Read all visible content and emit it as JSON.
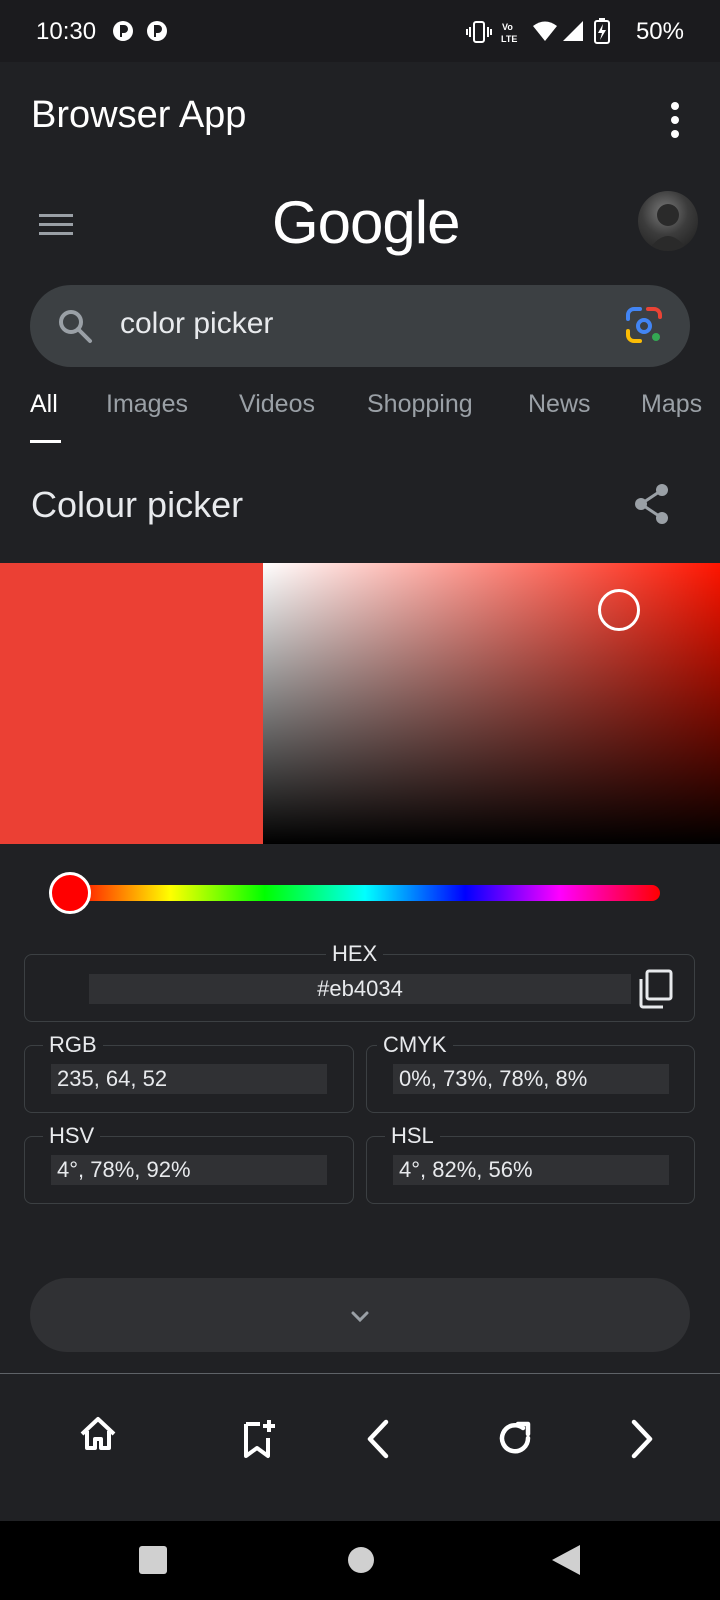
{
  "status_bar": {
    "time": "10:30",
    "battery": "50%",
    "icons": [
      "app-notification-icon",
      "app-notification-icon",
      "vibrate-icon",
      "volte-icon",
      "wifi-icon",
      "signal-icon",
      "battery-charging-icon"
    ]
  },
  "app_bar": {
    "title": "Browser App",
    "overflow_icon": "more-vert-icon"
  },
  "google": {
    "logo": "Google",
    "search": {
      "query": "color picker"
    },
    "tabs": [
      {
        "label": "All",
        "active": true
      },
      {
        "label": "Images"
      },
      {
        "label": "Videos"
      },
      {
        "label": "Shopping"
      },
      {
        "label": "News"
      },
      {
        "label": "Maps"
      }
    ]
  },
  "picker": {
    "title": "Colour picker",
    "selected_color": "#eb4034",
    "hue_color": "#ff1500",
    "saturation": 0.78,
    "value": 0.92,
    "hue_degrees": 4,
    "hex": {
      "label": "HEX",
      "value": "#eb4034"
    },
    "rgb": {
      "label": "RGB",
      "value": "235, 64, 52"
    },
    "cmyk": {
      "label": "CMYK",
      "value": "0%, 73%, 78%, 8%"
    },
    "hsv": {
      "label": "HSV",
      "value": "4°, 78%, 92%"
    },
    "hsl": {
      "label": "HSL",
      "value": "4°, 82%, 56%"
    }
  },
  "browser_bar": {
    "buttons": [
      "home-icon",
      "bookmark-add-icon",
      "back-icon",
      "refresh-icon",
      "forward-icon"
    ]
  },
  "colors": {
    "background": "#202124",
    "search_box": "#3c4043",
    "accent_white": "#ffffff"
  }
}
